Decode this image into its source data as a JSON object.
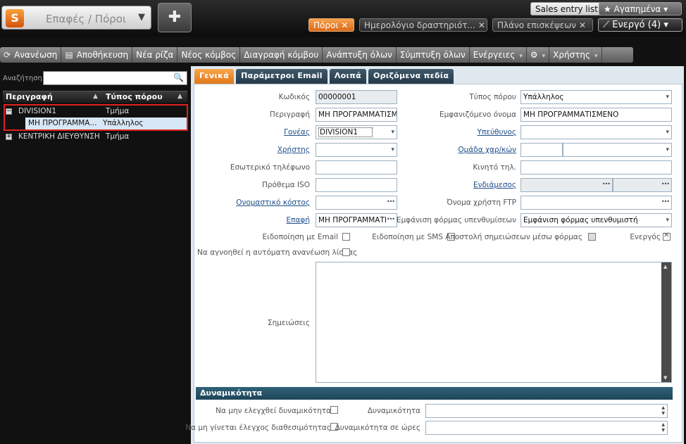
{
  "header": {
    "app_logo": "S",
    "app_title": "Επαφές / Πόροι",
    "sales_entry": "Sales entry list",
    "favorites": "★ Αγαπημένα ▾",
    "tabs": [
      {
        "label": "Πόροι",
        "close": "✕"
      },
      {
        "label": "Ημερολόγιο δραστηριότ...",
        "close": "✕"
      },
      {
        "label": "Πλάνο επισκέψεων",
        "close": "✕"
      },
      {
        "label": "⟋ Ενεργό (4) ▾"
      }
    ]
  },
  "toolbar": {
    "refresh": "Ανανέωση",
    "save": "Αποθήκευση",
    "new_root": "Νέα ρίζα",
    "new_node": "Νέος κόμβος",
    "delete_node": "Διαγραφή κόμβου",
    "expand_all": "Ανάπτυξη όλων",
    "collapse_all": "Σύμπτυξη όλων",
    "actions": "Ενέργειες",
    "user": "Χρήστης",
    "dd": "▾"
  },
  "tree": {
    "search_label": "Αναζήτηση",
    "search_value": "",
    "col_desc": "Περιγραφή",
    "col_type": "Τύπος πόρου",
    "sort": "▲",
    "rows": [
      {
        "expander": "−",
        "desc": "DIVISION1",
        "type": "Τμήμα"
      },
      {
        "desc": "ΜΗ ΠΡΟΓΡΑΜΜΑ...",
        "type": "Υπάλληλος"
      },
      {
        "expander": "+",
        "desc": "ΚΕΝΤΡΙΚΗ ΔΙΕΥΘΥΝΣΗ",
        "type": "Τμήμα"
      }
    ]
  },
  "form": {
    "tabs": [
      "Γενικά",
      "Παράμετροι Email",
      "Λοιπά",
      "Οριζόμενα πεδία"
    ],
    "labels": {
      "code": "Κωδικός",
      "description": "Περιγραφή",
      "parent": "Γονέας",
      "user": "Χρήστης",
      "internal_phone": "Εσωτερικό τηλέφωνο",
      "iso_prefix": "Πρόθεμα ISO",
      "cost_center": "Ονομαστικό κόστος",
      "contact": "Επαφή",
      "resource_type": "Τύπος πόρου",
      "display_name": "Εμφανιζόμενο όνομα",
      "responsible": "Υπεύθυνος",
      "skill_group": "Ομάδα χαρ/κών",
      "mobile": "Κινητό τηλ.",
      "intermediate": "Ενδιάμεσος",
      "ftp_user": "Όνομα χρήστη FTP",
      "reminder_form": "Εμφάνιση φόρμας υπενθυμίσεων",
      "email_notify": "Ειδοποίηση με Email",
      "sms_notify": "Ειδοποίηση με SMS",
      "send_notes": "Αποστολή σημειώσεων μέσω φόρμας",
      "active": "Ενεργός",
      "ignore_refresh": "Να αγνοηθεί η αυτόματη ανανέωση λίστας",
      "notes": "Σημειώσεις"
    },
    "values": {
      "code": "00000001",
      "description": "ΜΗ ΠΡΟΓΡΑΜΜΑΤΙΣΜΕ",
      "parent": "DIVISION1",
      "contact": "ΜΗ ΠΡΟΓΡΑΜΜΑΤΙ",
      "resource_type": "Υπάλληλος",
      "display_name": "ΜΗ ΠΡΟΓΡΑΜΜΑΤΙΣΜΕΝΟ",
      "reminder_form": "Εμφάνιση φόρμας υπενθυμιστή"
    },
    "capacity": {
      "title": "Δυναμικότητα",
      "no_check_capacity": "Να μην ελεγχθεί δυναμικότητα",
      "no_check_availability": "Να μη γίνεται έλεγχος διαθεσιμότητας",
      "capacity": "Δυναμικότητα",
      "capacity_hours": "Δυναμικότητα σε ώρες"
    }
  }
}
